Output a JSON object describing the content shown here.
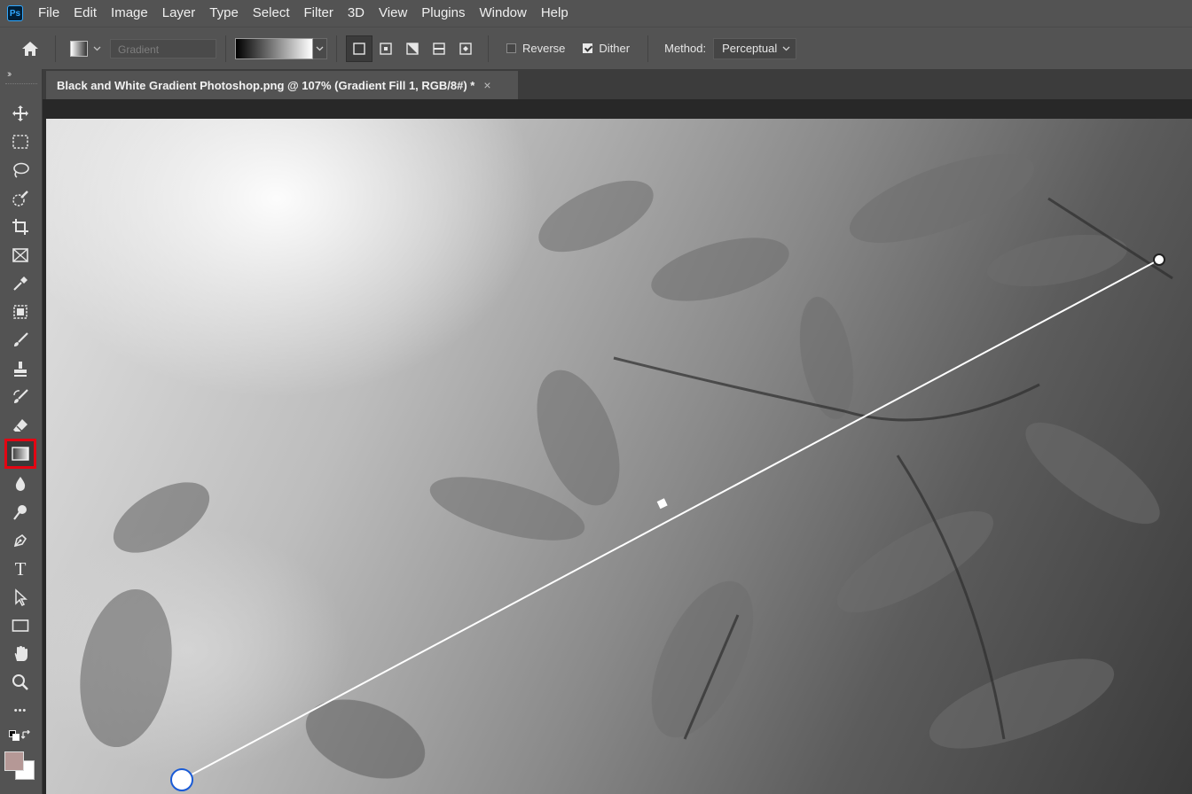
{
  "app": {
    "logo_text": "Ps"
  },
  "menubar": {
    "items": [
      "File",
      "Edit",
      "Image",
      "Layer",
      "Type",
      "Select",
      "Filter",
      "3D",
      "View",
      "Plugins",
      "Window",
      "Help"
    ]
  },
  "options": {
    "preset_placeholder": "Gradient",
    "reverse_label": "Reverse",
    "reverse_checked": false,
    "dither_label": "Dither",
    "dither_checked": true,
    "method_label": "Method:",
    "method_value": "Perceptual"
  },
  "document": {
    "tab_title": "Black and White Gradient Photoshop.png @ 107% (Gradient Fill 1, RGB/8#) *",
    "close_glyph": "×"
  },
  "toolbar": {
    "collapse_glyph": "››",
    "more_glyph": "•••",
    "tools": [
      "move-tool",
      "rectangular-marquee-tool",
      "lasso-tool",
      "quick-selection-tool",
      "crop-tool",
      "frame-tool",
      "eyedropper-tool",
      "object-selection-tool",
      "brush-tool",
      "clone-stamp-tool",
      "history-brush-tool",
      "eraser-tool",
      "gradient-tool",
      "blur-tool",
      "dodge-tool",
      "pen-tool",
      "type-tool",
      "path-selection-tool",
      "rectangle-tool",
      "hand-tool",
      "zoom-tool",
      "edit-toolbar"
    ],
    "selected_tool": "gradient-tool",
    "type_glyph": "T"
  },
  "colors": {
    "foreground": "#b59896",
    "background": "#ffffff",
    "selected_highlight": "#e30613"
  }
}
